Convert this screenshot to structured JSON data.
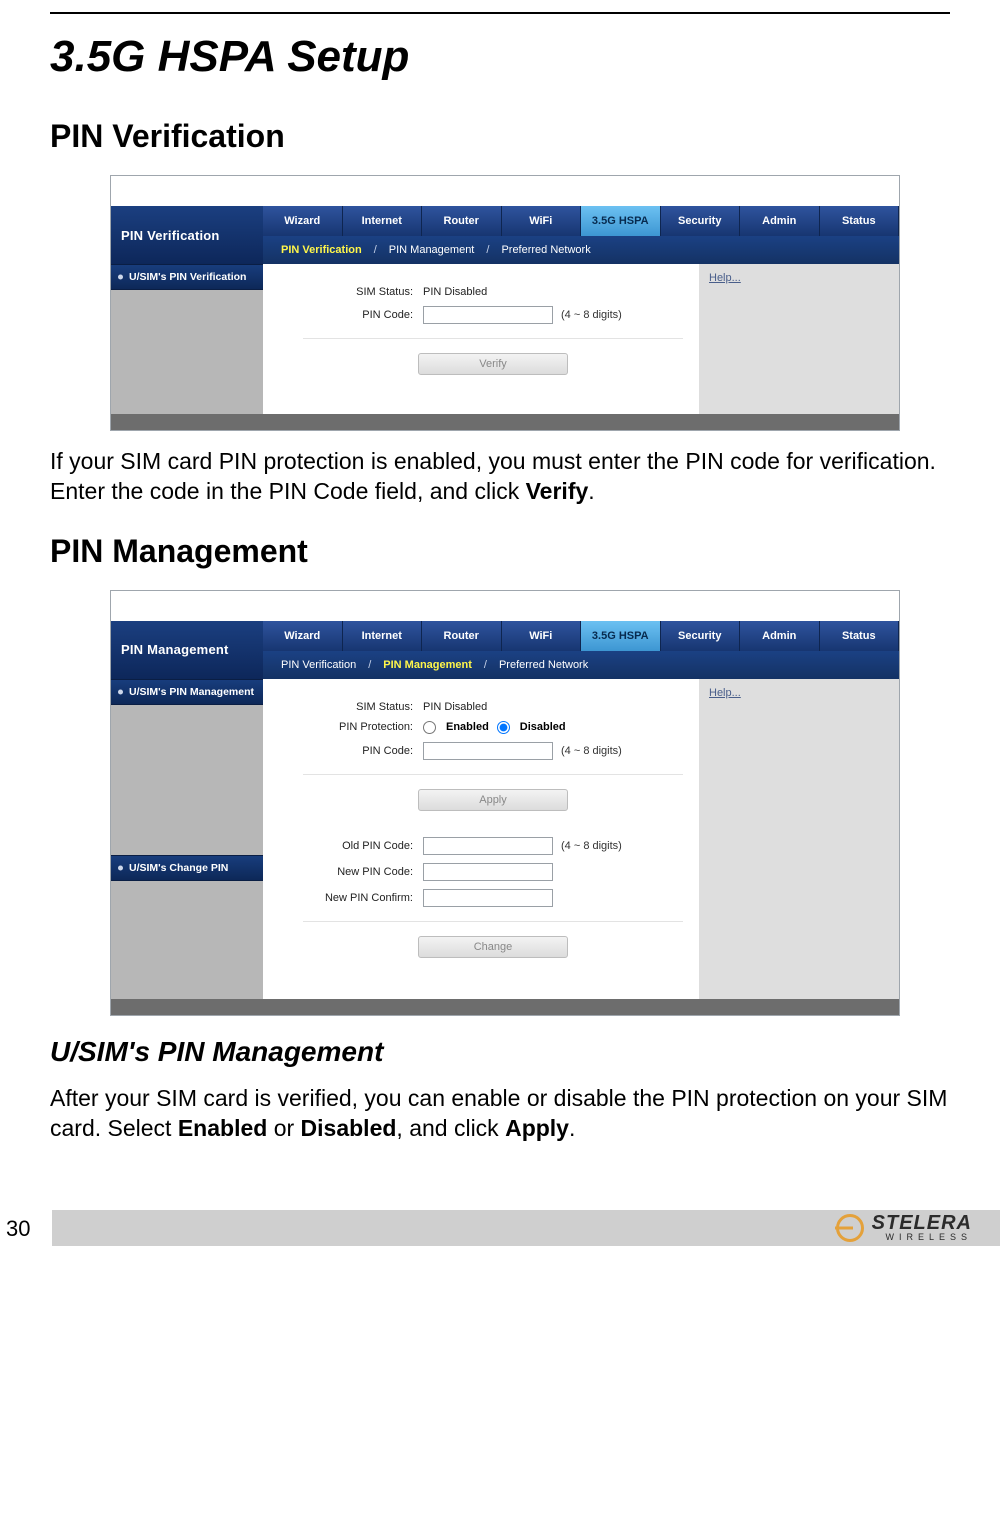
{
  "page": {
    "number": "30",
    "chapter_title": "3.5G HSPA Setup",
    "section1_title": "PIN Verification",
    "section2_title": "PIN Management",
    "subsection_title": "U/SIM's PIN Management",
    "para1_a": "If your SIM card PIN protection is enabled, you must enter the PIN code for verification. Enter the code in the PIN Code field, and click ",
    "para1_b": "Verify",
    "para1_c": ".",
    "para2_a": "After your SIM card is verified, you can enable or disable the PIN protection on your SIM card. Select ",
    "para2_b": "Enabled",
    "para2_c": " or ",
    "para2_d": "Disabled",
    "para2_e": ", and click ",
    "para2_f": "Apply",
    "para2_g": "."
  },
  "tabs": {
    "t0": "Wizard",
    "t1": "Internet",
    "t2": "Router",
    "t3": "WiFi",
    "t4": "3.5G HSPA",
    "t5": "Security",
    "t6": "Admin",
    "t7": "Status"
  },
  "subtabs": {
    "s0": "PIN Verification",
    "s1": "PIN Management",
    "s2": "Preferred Network",
    "sep": "/"
  },
  "common": {
    "help": "Help...",
    "sim_status_label": "SIM Status:",
    "sim_status_value": "PIN Disabled",
    "pin_code_label": "PIN Code:",
    "pin_hint": "(4 ~ 8 digits)"
  },
  "shot1": {
    "title": "PIN Verification",
    "side_item": "U/SIM's PIN Verification",
    "verify_btn": "Verify"
  },
  "shot2": {
    "title": "PIN Management",
    "side_item1": "U/SIM's PIN Management",
    "side_item2": "U/SIM's Change PIN",
    "protection_label": "PIN Protection:",
    "opt_enabled": "Enabled",
    "opt_disabled": "Disabled",
    "apply_btn": "Apply",
    "old_pin_label": "Old PIN Code:",
    "new_pin_label": "New PIN Code:",
    "new_pin_confirm_label": "New PIN Confirm:",
    "change_btn": "Change"
  },
  "footer": {
    "brand": "STELERA",
    "tag": "WIRELESS"
  }
}
